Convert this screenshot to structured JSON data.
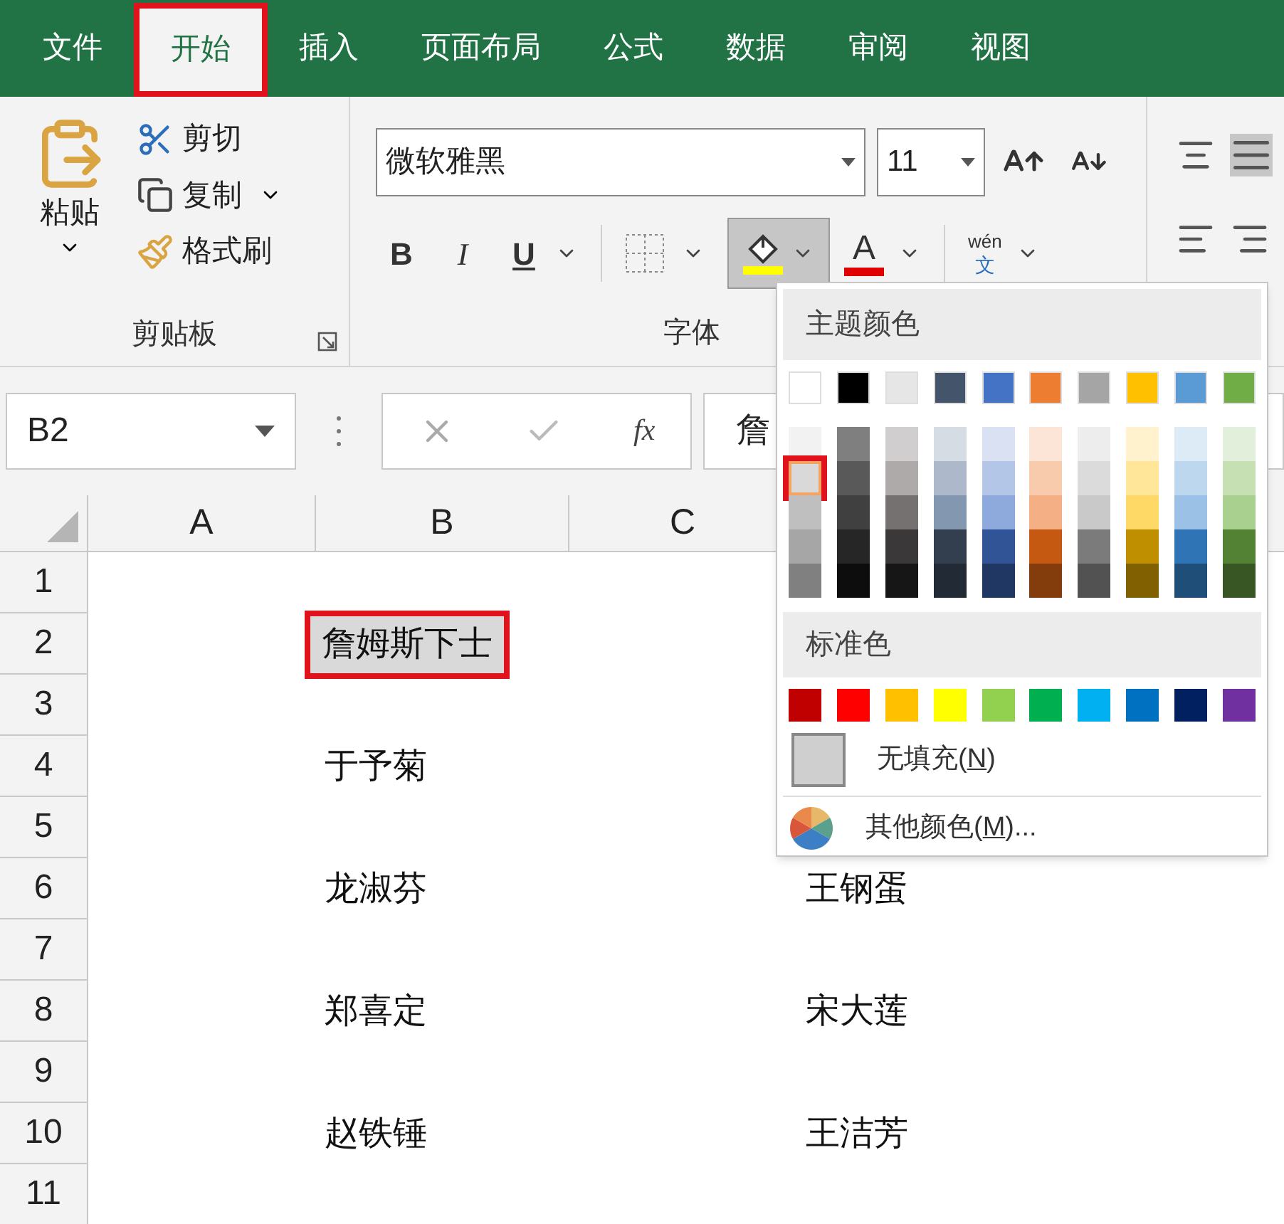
{
  "tabs": [
    {
      "label": "文件",
      "selected": false
    },
    {
      "label": "开始",
      "selected": true
    },
    {
      "label": "插入",
      "selected": false
    },
    {
      "label": "页面布局",
      "selected": false
    },
    {
      "label": "公式",
      "selected": false
    },
    {
      "label": "数据",
      "selected": false
    },
    {
      "label": "审阅",
      "selected": false
    },
    {
      "label": "视图",
      "selected": false
    }
  ],
  "clipboard": {
    "paste": "粘贴",
    "cut": "剪切",
    "copy": "复制",
    "format_painter": "格式刷",
    "group_label": "剪贴板"
  },
  "font": {
    "name": "微软雅黑",
    "size": "11",
    "bold": "B",
    "italic": "I",
    "underline": "U",
    "font_color": "A",
    "phonetic_top": "wén",
    "phonetic_bottom": "文",
    "group_label": "字体"
  },
  "formula_bar": {
    "name_box": "B2",
    "function_label": "fx",
    "value": "詹"
  },
  "columns": [
    "A",
    "B",
    "C"
  ],
  "rows": [
    {
      "number": "1"
    },
    {
      "number": "2",
      "column_b": {
        "text": "詹姆斯下士",
        "selected": true
      }
    },
    {
      "number": "3"
    },
    {
      "number": "4",
      "column_b": {
        "text": "于予菊",
        "selected": false
      }
    },
    {
      "number": "5"
    },
    {
      "number": "6",
      "column_b": {
        "text": "龙淑芬",
        "selected": false
      },
      "column_d": {
        "text": "王钢蛋",
        "selected": false
      }
    },
    {
      "number": "7"
    },
    {
      "number": "8",
      "column_b": {
        "text": "郑喜定",
        "selected": false
      },
      "column_d": {
        "text": "宋大莲",
        "selected": false
      }
    },
    {
      "number": "9"
    },
    {
      "number": "10",
      "column_b": {
        "text": "赵铁锤",
        "selected": false
      },
      "column_d": {
        "text": "王洁芳",
        "selected": false
      }
    },
    {
      "number": "11"
    }
  ],
  "fill_menu": {
    "theme_title": "主题颜色",
    "theme_colors": [
      {
        "color": "#ffffff",
        "shades": [
          {
            "color": "#f2f2f2",
            "selected": false
          },
          {
            "color": "#d9d9d9",
            "selected": true
          },
          {
            "color": "#bfbfbf",
            "selected": false
          },
          {
            "color": "#a6a6a6",
            "selected": false
          },
          {
            "color": "#808080",
            "selected": false
          }
        ]
      },
      {
        "color": "#000000",
        "shades": [
          {
            "color": "#7f7f7f",
            "selected": false
          },
          {
            "color": "#595959",
            "selected": false
          },
          {
            "color": "#404040",
            "selected": false
          },
          {
            "color": "#262626",
            "selected": false
          },
          {
            "color": "#0d0d0d",
            "selected": false
          }
        ]
      },
      {
        "color": "#e7e6e6",
        "shades": [
          {
            "color": "#d0cece",
            "selected": false
          },
          {
            "color": "#aeaaaa",
            "selected": false
          },
          {
            "color": "#757171",
            "selected": false
          },
          {
            "color": "#3a3838",
            "selected": false
          },
          {
            "color": "#161616",
            "selected": false
          }
        ]
      },
      {
        "color": "#44546a",
        "shades": [
          {
            "color": "#d6dce4",
            "selected": false
          },
          {
            "color": "#adb9ca",
            "selected": false
          },
          {
            "color": "#8497b0",
            "selected": false
          },
          {
            "color": "#333f4f",
            "selected": false
          },
          {
            "color": "#222b35",
            "selected": false
          }
        ]
      },
      {
        "color": "#4472c4",
        "shades": [
          {
            "color": "#d9e1f2",
            "selected": false
          },
          {
            "color": "#b4c6e7",
            "selected": false
          },
          {
            "color": "#8ea9db",
            "selected": false
          },
          {
            "color": "#305496",
            "selected": false
          },
          {
            "color": "#203764",
            "selected": false
          }
        ]
      },
      {
        "color": "#ed7d31",
        "shades": [
          {
            "color": "#fce4d6",
            "selected": false
          },
          {
            "color": "#f8cbad",
            "selected": false
          },
          {
            "color": "#f4b084",
            "selected": false
          },
          {
            "color": "#c65911",
            "selected": false
          },
          {
            "color": "#833c0c",
            "selected": false
          }
        ]
      },
      {
        "color": "#a5a5a5",
        "shades": [
          {
            "color": "#ededed",
            "selected": false
          },
          {
            "color": "#dbdbdb",
            "selected": false
          },
          {
            "color": "#c9c9c9",
            "selected": false
          },
          {
            "color": "#7b7b7b",
            "selected": false
          },
          {
            "color": "#525252",
            "selected": false
          }
        ]
      },
      {
        "color": "#ffc000",
        "shades": [
          {
            "color": "#fff2cc",
            "selected": false
          },
          {
            "color": "#ffe699",
            "selected": false
          },
          {
            "color": "#ffd966",
            "selected": false
          },
          {
            "color": "#bf8f00",
            "selected": false
          },
          {
            "color": "#806000",
            "selected": false
          }
        ]
      },
      {
        "color": "#5b9bd5",
        "shades": [
          {
            "color": "#ddebf7",
            "selected": false
          },
          {
            "color": "#bdd7ee",
            "selected": false
          },
          {
            "color": "#9bc2e6",
            "selected": false
          },
          {
            "color": "#2f75b5",
            "selected": false
          },
          {
            "color": "#1f4e78",
            "selected": false
          }
        ]
      },
      {
        "color": "#70ad47",
        "shades": [
          {
            "color": "#e2efda",
            "selected": false
          },
          {
            "color": "#c6e0b4",
            "selected": false
          },
          {
            "color": "#a9d08e",
            "selected": false
          },
          {
            "color": "#548235",
            "selected": false
          },
          {
            "color": "#375623",
            "selected": false
          }
        ]
      }
    ],
    "standard_title": "标准色",
    "standard_colors": [
      {
        "color": "#c00000"
      },
      {
        "color": "#ff0000"
      },
      {
        "color": "#ffc000"
      },
      {
        "color": "#ffff00"
      },
      {
        "color": "#92d050"
      },
      {
        "color": "#00b050"
      },
      {
        "color": "#00b0f0"
      },
      {
        "color": "#0070c0"
      },
      {
        "color": "#002060"
      },
      {
        "color": "#7030a0"
      }
    ],
    "no_fill": {
      "before": "无填充(",
      "key": "N",
      "after": ")"
    },
    "more_colors": {
      "before": "其他颜色(",
      "key": "M",
      "after": ")..."
    }
  }
}
